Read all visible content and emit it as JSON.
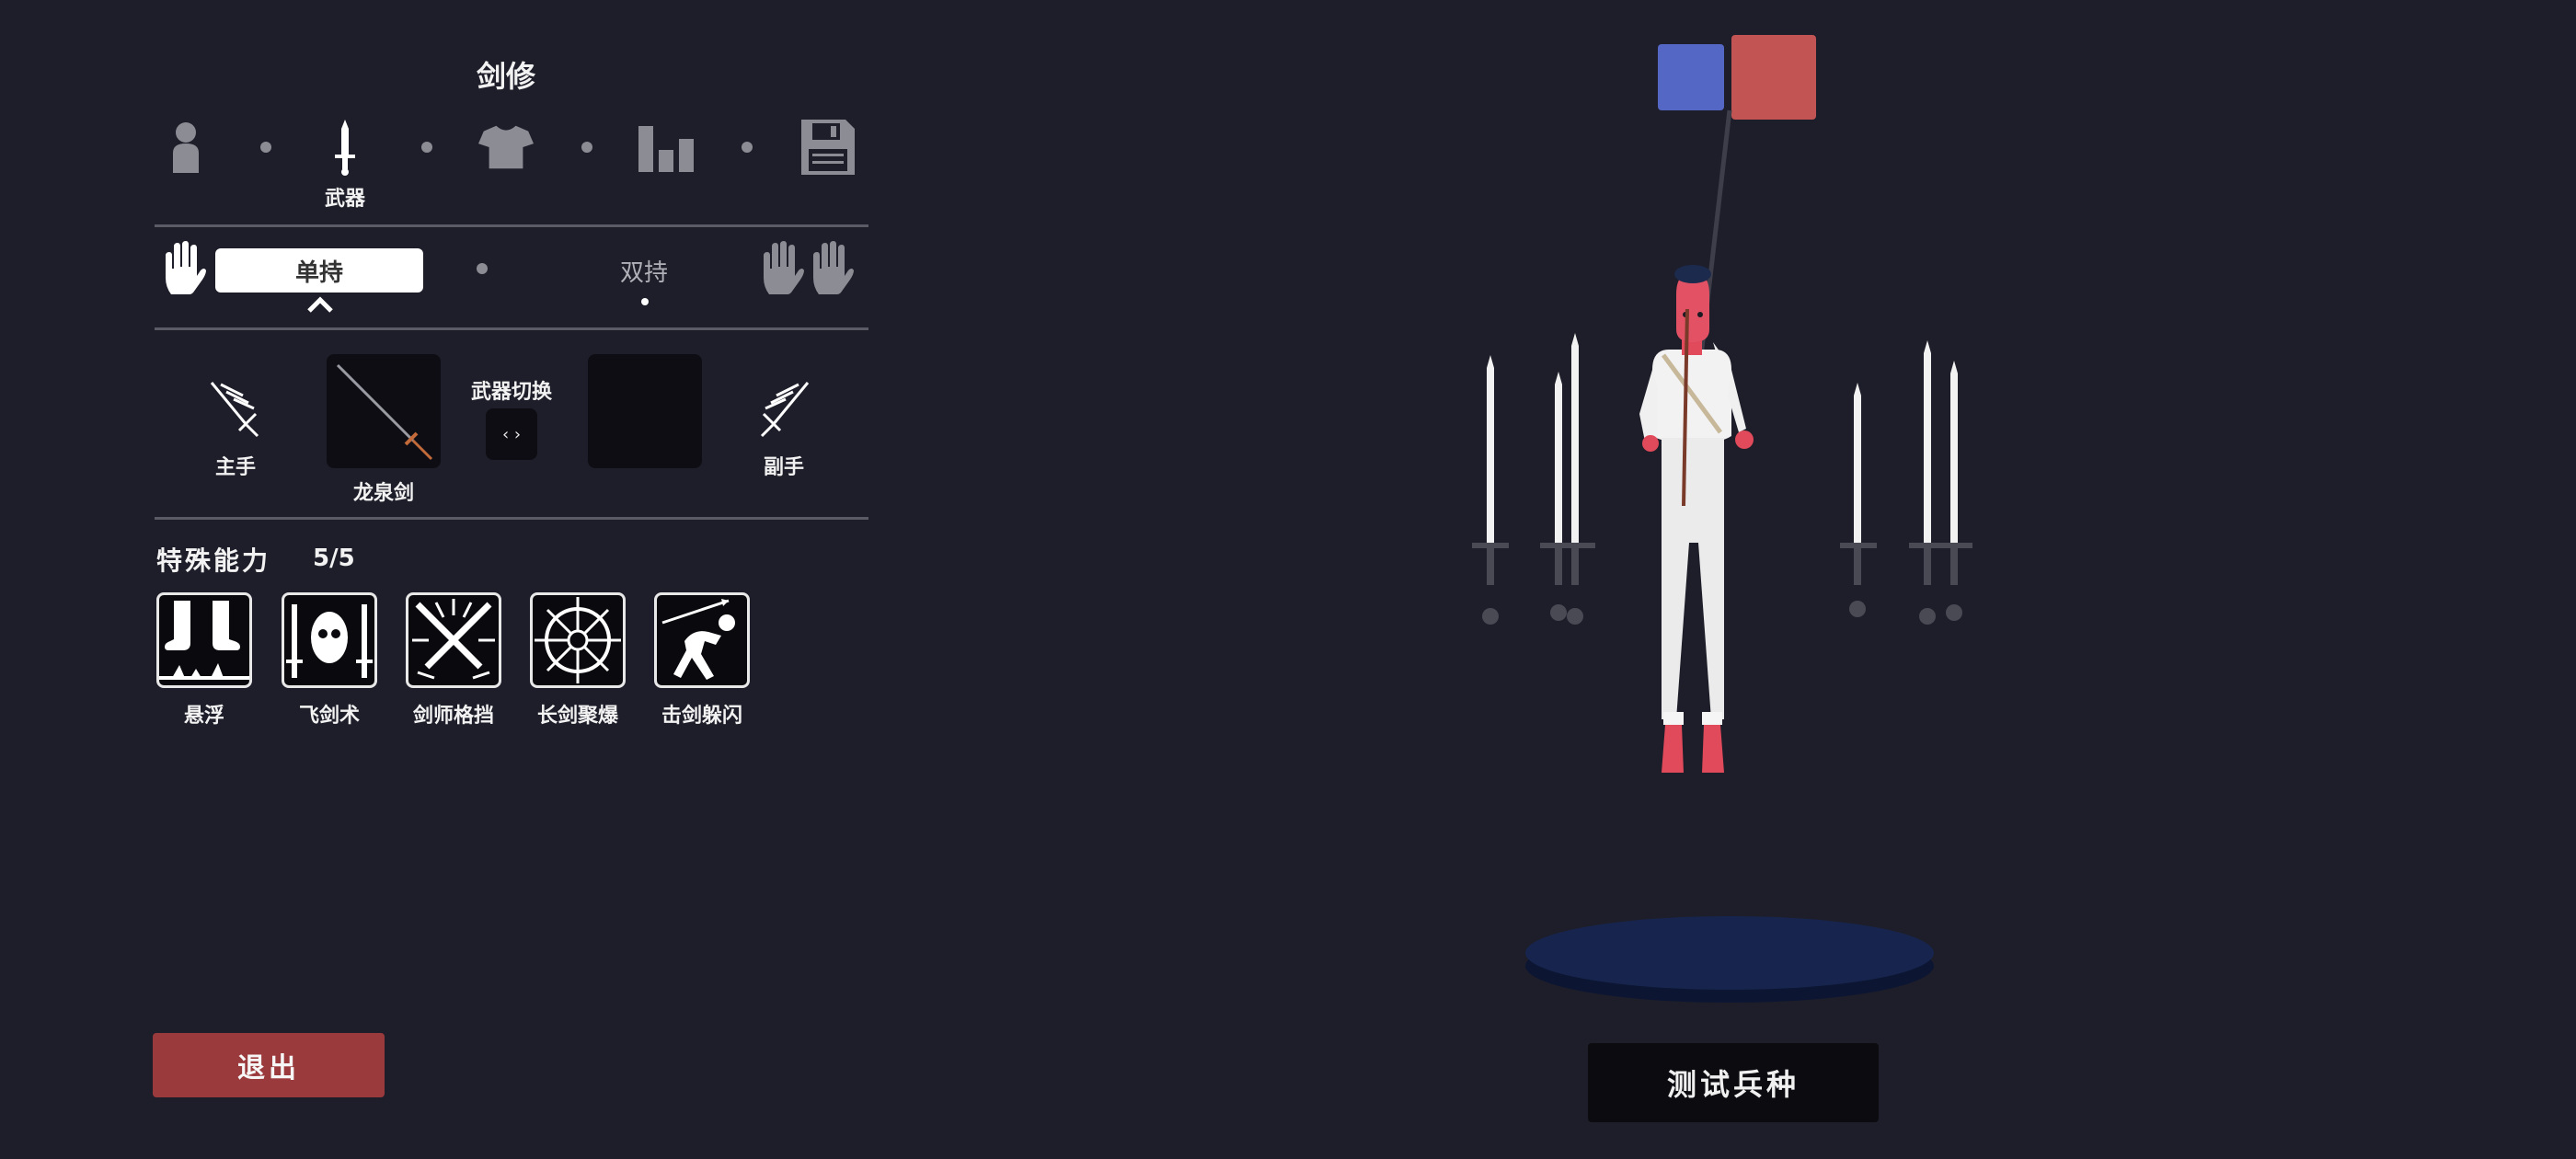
{
  "unit": {
    "name": "剑修"
  },
  "tabs": [
    {
      "id": "body",
      "icon": "person-icon",
      "label": ""
    },
    {
      "id": "weapon",
      "icon": "sword-icon",
      "label": "武器"
    },
    {
      "id": "clothing",
      "icon": "shirt-icon",
      "label": ""
    },
    {
      "id": "stats",
      "icon": "bar-chart-icon",
      "label": ""
    },
    {
      "id": "save",
      "icon": "floppy-disk-icon",
      "label": ""
    }
  ],
  "grip": {
    "single_label": "单持",
    "dual_label": "双持",
    "selected": "单持"
  },
  "weapons": {
    "main_hand_label": "主手",
    "off_hand_label": "副手",
    "main_weapon_name": "龙泉剑",
    "swap_label": "武器切换",
    "swap_icon": "‹ ›"
  },
  "abilities": {
    "header": "特殊能力",
    "count": "5/5",
    "items": [
      {
        "label": "悬浮",
        "icon": "levitate-icon"
      },
      {
        "label": "飞剑术",
        "icon": "flying-sword-icon"
      },
      {
        "label": "剑师格挡",
        "icon": "crossed-swords-icon"
      },
      {
        "label": "长剑聚爆",
        "icon": "blade-burst-icon"
      },
      {
        "label": "击剑躲闪",
        "icon": "fencing-dodge-icon"
      }
    ]
  },
  "buttons": {
    "exit": "退出",
    "test_unit": "测试兵种"
  },
  "colors": {
    "team_blue": "#5567c4",
    "team_red": "#c25454",
    "exit_bg": "#9a3a3c",
    "background": "#1e1e2a"
  }
}
